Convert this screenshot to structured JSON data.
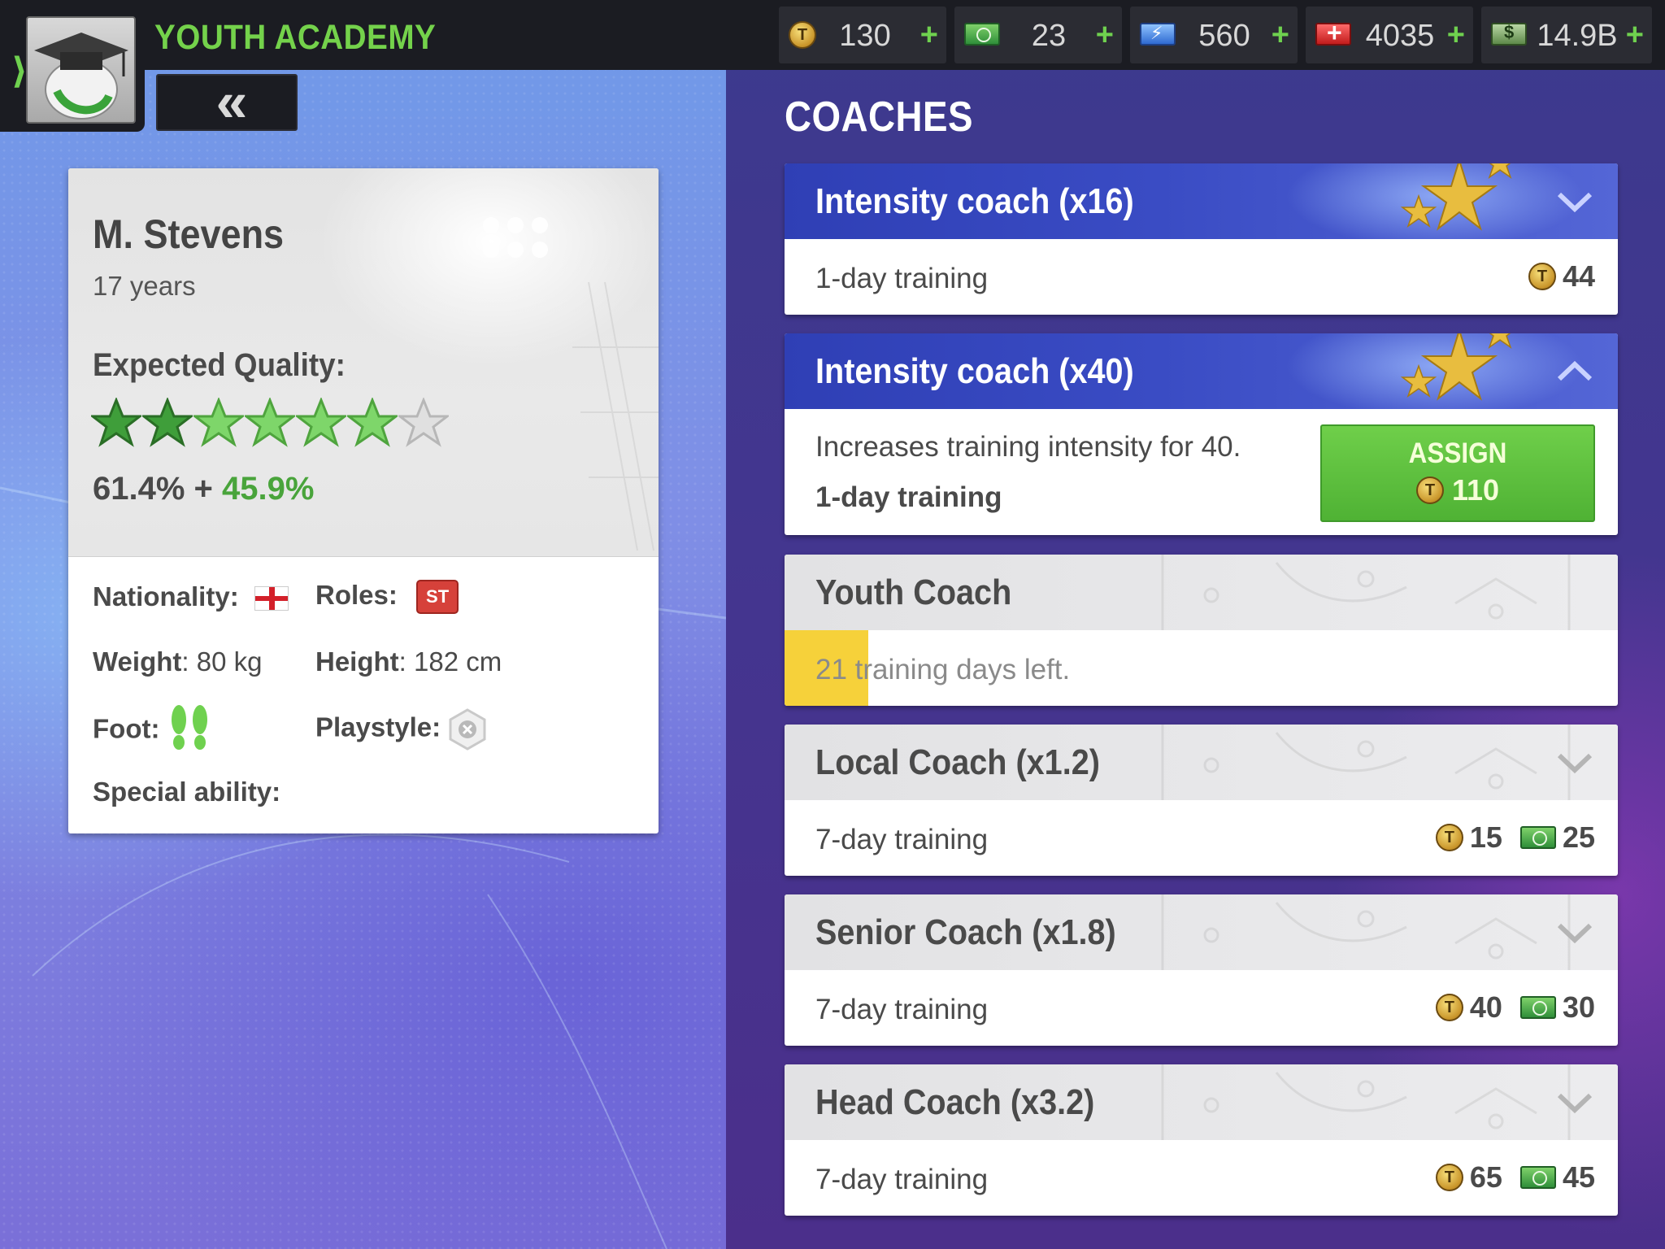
{
  "app": {
    "title": "YOUTH ACADEMY",
    "back_label": "«"
  },
  "currencies": [
    {
      "name": "tokens",
      "icon": "coin-icon",
      "value": "130",
      "plus": "+"
    },
    {
      "name": "cash",
      "icon": "cash-icon",
      "value": "23",
      "plus": "+"
    },
    {
      "name": "energy",
      "icon": "energy-icon",
      "value": "560",
      "plus": "+"
    },
    {
      "name": "medkits",
      "icon": "medkit-icon",
      "value": "4035",
      "plus": "+"
    },
    {
      "name": "money",
      "icon": "money-icon",
      "value": "14.9B",
      "plus": "+"
    }
  ],
  "player": {
    "name": "M. Stevens",
    "age": "17 years",
    "expected_quality_label": "Expected Quality:",
    "stars": {
      "full_dark": 2,
      "full_light": 4,
      "empty": 1,
      "total": 7
    },
    "quality_base": "61.4%",
    "quality_plus": " + ",
    "quality_bonus": "45.9%",
    "nationality_label": "Nationality:",
    "nationality_flag": "England",
    "roles_label": "Roles:",
    "role": "ST",
    "weight_label": "Weight",
    "weight_value": ": 80 kg",
    "height_label": "Height",
    "height_value": ": 182 cm",
    "foot_label": "Foot:",
    "playstyle_label": "Playstyle:",
    "special_ability_label": "Special ability:"
  },
  "coaches_title": "COACHES",
  "coaches": [
    {
      "title": "Intensity coach (x16)",
      "duration": "1-day training",
      "price_tokens": "44",
      "state": "collapsed",
      "style": "premium"
    },
    {
      "title": "Intensity coach (x40)",
      "description": "Increases training intensity for 40.",
      "duration": "1-day training",
      "assign_label": "ASSIGN",
      "assign_cost": "110",
      "state": "expanded",
      "style": "premium"
    },
    {
      "title": "Youth Coach",
      "status": "21 training days left.",
      "progress": 0.1,
      "style": "standard"
    },
    {
      "title": "Local Coach (x1.2)",
      "duration": "7-day training",
      "price_tokens": "15",
      "price_cash": "25",
      "state": "collapsed",
      "style": "standard"
    },
    {
      "title": "Senior Coach (x1.8)",
      "duration": "7-day training",
      "price_tokens": "40",
      "price_cash": "30",
      "state": "collapsed",
      "style": "standard"
    },
    {
      "title": "Head Coach (x3.2)",
      "duration": "7-day training",
      "price_tokens": "65",
      "price_cash": "45",
      "state": "collapsed",
      "style": "standard"
    }
  ],
  "colors": {
    "accent_green": "#74d24b",
    "assign_green": "#5ec13e",
    "premium_blue": "#3a4cc4",
    "progress_yellow": "#f6d13a"
  }
}
